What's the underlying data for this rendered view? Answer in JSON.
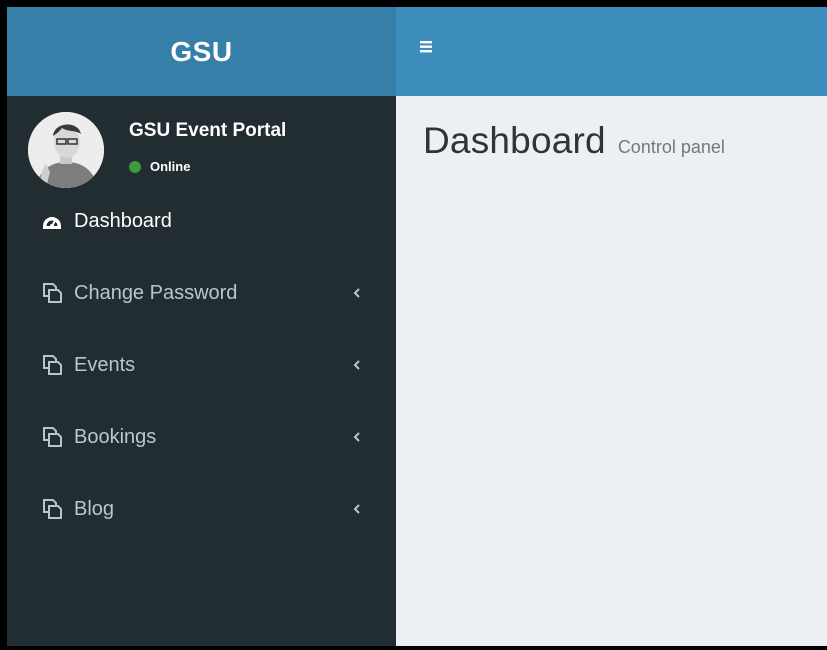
{
  "header": {
    "logo": "GSU",
    "toggle_icon": "hamburger-icon"
  },
  "user": {
    "name": "GSU Event Portal",
    "status": "Online",
    "status_color": "#3c9a3c"
  },
  "sidebar": {
    "items": [
      {
        "label": "Dashboard",
        "icon": "dashboard-icon",
        "has_submenu": false
      },
      {
        "label": "Change Password",
        "icon": "copy-icon",
        "has_submenu": true
      },
      {
        "label": "Events",
        "icon": "copy-icon",
        "has_submenu": true
      },
      {
        "label": "Bookings",
        "icon": "copy-icon",
        "has_submenu": true
      },
      {
        "label": "Blog",
        "icon": "copy-icon",
        "has_submenu": true
      }
    ]
  },
  "main": {
    "title": "Dashboard",
    "subtitle": "Control panel"
  },
  "colors": {
    "logo_bg": "#367fa9",
    "navbar_bg": "#3c8dbc",
    "sidebar_bg": "#222d32",
    "content_bg": "#ecf0f5"
  }
}
